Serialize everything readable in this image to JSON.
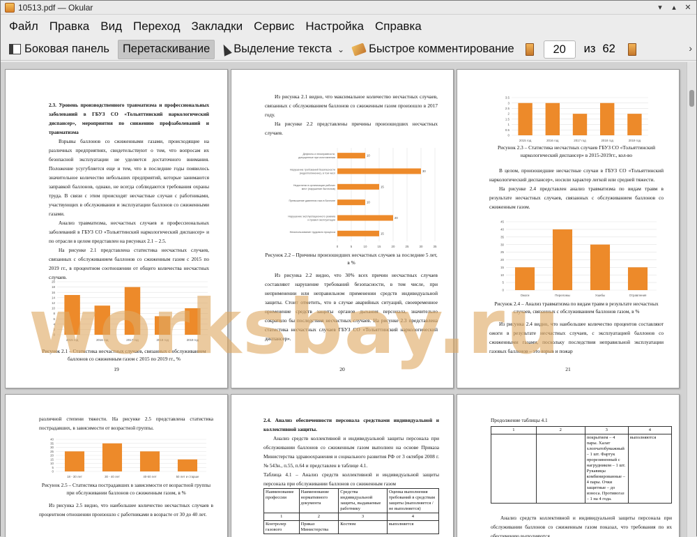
{
  "window": {
    "title": "10513.pdf — Okular"
  },
  "menu": [
    "Файл",
    "Правка",
    "Вид",
    "Переход",
    "Закладки",
    "Сервис",
    "Настройка",
    "Справка"
  ],
  "toolbar": {
    "sidebar": "Боковая панель",
    "drag": "Перетаскивание",
    "select_text": "Выделение текста",
    "quick_annot": "Быстрое комментирование",
    "page_current": "20",
    "of": "из",
    "page_total": "62"
  },
  "watermark": "worksbay.ru",
  "pages": {
    "p19": {
      "heading": "2.3. Уровень производственного травматизма и профессиональных заболеваний в ГБУЗ СО «Тольяттинский наркологический диспансер», мероприятия по снижению профзаболеваний и травматизма",
      "para1": "Взрывы баллонов со сжиженными газами, происходящие на различных предприятиях, свидетельствуют о том, что вопросам их безопасной эксплуатации не уделяется достаточного внимания. Положение усугубляется еще и тем, что в последние годы появилось значительное количество небольших предприятий, которые занимаются заправкой баллонов, однако, не всегда соблюдаются требования охраны труда. В связи с этим происходят несчастные случаи с работниками, участвующих в обслуживании и эксплуатации баллонов со сжиженными газами.",
      "para2": "Анализ травматизма, несчастных случаев и профессиональных заболеваний в ГБУЗ СО «Тольяттинский наркологический диспансер» и по отрасли в целом представлен на рисунках 2.1 – 2.5.",
      "para3": "На рисунке 2.1 представлена статистика несчастных случаев, связанных с обслуживанием баллонов со сжиженным газом с 2015 по 2019 гг., в процентном соотношении от общего количества несчастных случаев.",
      "caption": "Рисунок 2.1 – Статистика несчастных случаев, связанных с обслуживанием баллонов со сжиженным газом с 2015 по 2019 гг., %",
      "number": "19"
    },
    "p20": {
      "para1": "Из рисунка 2.1 видно, что максимальное количество несчастных случаев, связанных с обслуживанием баллонов со сжиженным газом произошло в 2017 году.",
      "para2": "На рисунке 2.2 представлены причины произошедших несчастных случаев.",
      "caption": "Рисунок 2.2 – Причины произошедших несчастных случаев за последние 5 лет, в %",
      "para3": "Из рисунка 2.2 видно, что 30% всех причин несчастных случаев составляют нарушение требований безопасности, в том числе, при неприменении или неправильном применении средств индивидуальной защиты. Стоит отметить, что в случае аварийных ситуаций, своевременное применение средств защиты органов дыхания персонала, значительно сократило бы последствия несчастных случаев. На рисунке 2.3 представлена статистика несчастных случаев ГБУЗ СО «Тольяттинский наркологический диспансер».",
      "number": "20"
    },
    "p21": {
      "caption1": "Рисунок 2.3 – Статистика несчастных случаев ГБУЗ СО «Тольяттинский наркологический диспансер» в 2015-2019гг., кол-во",
      "para1": "В целом, произошедшие несчастные случаи в ГБУЗ СО «Тольяттинский наркологический диспансер», носили характер легкой или средней тяжести.",
      "para2": "На рисунке 2.4 представлен анализ травматизма по видам травм в результате несчастных случаев, связанных с обслуживанием баллонов со сжиженным газом.",
      "caption2": "Рисунок 2.4 – Анализ травматизма по видам травм в результате несчастных случаев, связанных с обслуживанием баллонов газом, в %",
      "para3": "Из рисунка 2.4 видно, что наибольшее количество процентов составляют ожоги в результате несчастных случаев, с эксплуатацией баллонов со сжиженными газами, поскольку последствия неправильной эксплуатации газовых баллонов – это взрыв и пожар",
      "number": "21"
    },
    "p22": {
      "para1": "различной степени тяжести. На рисунке 2.5 представлена статистика пострадавших, в зависимости от возрастной группы.",
      "caption": "Рисунок 2.5 – Статистика пострадавших в зависимости от возрастной группы при обслуживании баллонов со сжиженным газом, в %",
      "para2": "Из рисунка 2.5 видно, что наибольшее количество несчастных случаев в процентном отношении произошло с работниками в возрасте от 30 до 40 лет."
    },
    "p23": {
      "heading": "2.4. Анализ обеспеченности персонала средствами индивидуальной и коллективной защиты.",
      "para1": "Анализ средств коллективной и индивидуальной защиты персонала при обслуживании баллонов со сжиженным газом выполнен на основе Приказа Министерства здравоохранения и социального развития РФ от 3 октября 2008 г. № 543н., п.55, п.64 и представлен в таблице 4.1.",
      "table_caption": "Таблица 4.1 – Анализ средств коллективной и индивидуальной защиты персонала при обслуживании баллонов со сжиженным газом",
      "headers": [
        "Наименование профессии",
        "Наименование нормативного документа",
        "Средства индивидуальной защиты, выдаваемые работнику",
        "Оценка выполнения требований в средствам защиты (выполняется / не выполняется)"
      ],
      "nums": [
        "1",
        "2",
        "3",
        "4"
      ],
      "row1": [
        "Контролер газового",
        "Приказ Министерства",
        "Костюм",
        "выполняется"
      ]
    },
    "p24": {
      "cont": "Продолжение таблицы 4.1",
      "nums": [
        "1",
        "2",
        "3",
        "4"
      ],
      "cell3": "покрытием – 4 пары. Халат хлопчатобумажный – 1 шт. Фартук прорезиненный с нагрудником – 1 шт. Рукавицы комбинированные – 4 пары. Очки защитные – до износа. Противогаз – 1 на 4 года.",
      "cell4": "выполняются",
      "para1": "Анализ средств коллективной и индивидуальной защиты персонала при обслуживании баллонов со сжиженным газом показал, что требования по их обеспечению выполняются."
    }
  },
  "chart_data": [
    {
      "type": "bar",
      "title": "",
      "categories": [
        "2015 год",
        "2016 год",
        "2017 год",
        "2018 год",
        "2019 год"
      ],
      "values": [
        15,
        11,
        18,
        7,
        10
      ],
      "ylim": [
        0,
        20
      ],
      "yticks": [
        "0",
        "2",
        "4",
        "6",
        "8",
        "10",
        "12",
        "14",
        "16",
        "18",
        "20"
      ],
      "color": "#ed8a2a"
    },
    {
      "type": "bar",
      "orientation": "horizontal",
      "title": "",
      "categories": [
        "Дефекты и неисправности, допущенные при изготовлении баллонов",
        "Нарушение требований безопасности (неделпопинение), в том числе, при неприменении или неправильном применении средств индивидуальной защиты",
        "Недостатки в организации рабочих мест (нарушение баллонов)",
        "Превышение давления газа в баллоне",
        "Нарушение эксплуатационного режима и правил эксплуатации",
        "Неиспользование трудового процесса"
      ],
      "values": [
        10,
        30,
        15,
        10,
        20,
        15
      ],
      "xlim": [
        0,
        35
      ],
      "xticks": [
        "0",
        "5",
        "10",
        "15",
        "20",
        "25",
        "30",
        "35"
      ],
      "data_labels": [
        "10",
        "30",
        "15",
        "10",
        "20",
        "15"
      ],
      "color": "#ed8a2a"
    },
    {
      "type": "bar",
      "title": "",
      "categories": [
        "2015 год",
        "2016 год",
        "2017 год",
        "2018 год",
        "2019 год"
      ],
      "values": [
        3,
        3,
        2,
        3,
        2
      ],
      "ylim": [
        0,
        3.5
      ],
      "yticks": [
        "0",
        "0.5",
        "1",
        "1.5",
        "2",
        "2.5",
        "3",
        "3.5"
      ],
      "color": "#ed8a2a"
    },
    {
      "type": "bar",
      "title": "",
      "categories": [
        "Ожоги",
        "Переломы",
        "Ушибы",
        "Отравления"
      ],
      "values": [
        15,
        40,
        30,
        15
      ],
      "ylim": [
        0,
        45
      ],
      "yticks": [
        "0",
        "5",
        "10",
        "15",
        "20",
        "25",
        "30",
        "35",
        "40",
        "45"
      ],
      "color": "#ed8a2a"
    },
    {
      "type": "bar",
      "title": "",
      "categories": [
        "18 - 30 лет",
        "30 - 40 лет",
        "40-50 лет",
        "50 лет и старше"
      ],
      "values": [
        25,
        35,
        25,
        15
      ],
      "ylim": [
        0,
        40
      ],
      "yticks": [
        "0",
        "5",
        "10",
        "15",
        "20",
        "25",
        "30",
        "35",
        "40"
      ],
      "color": "#ed8a2a"
    }
  ]
}
